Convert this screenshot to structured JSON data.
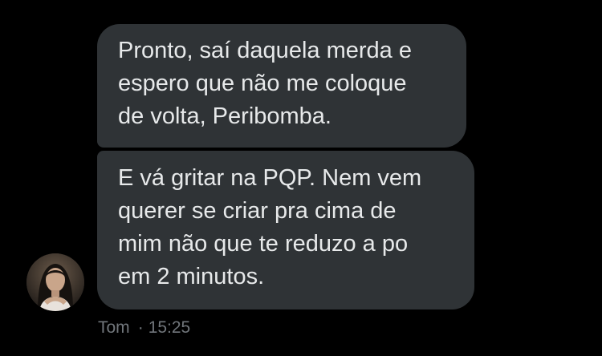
{
  "messages": [
    {
      "lines": [
        "Pronto, saí daquela merda e",
        "espero que não me coloque",
        "de volta, Peribomba."
      ]
    },
    {
      "lines": [
        "E vá gritar na PQP. Nem vem",
        "querer se criar pra cima de",
        "mim não que te reduzo a po",
        "em 2 minutos."
      ]
    }
  ],
  "sender": {
    "name": "Tom",
    "time": "15:25",
    "separator": "·"
  },
  "colors": {
    "background": "#000000",
    "bubble": "#2f3336",
    "text": "#e7e9ea",
    "meta": "#71767b"
  }
}
